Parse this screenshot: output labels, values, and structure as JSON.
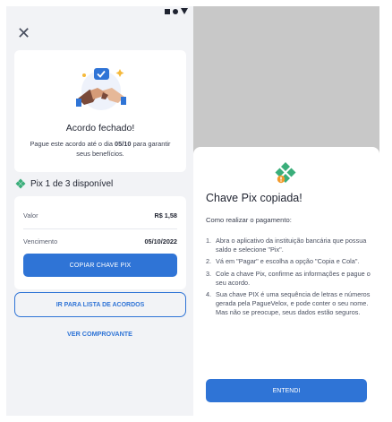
{
  "left_screen": {
    "close_icon": "close-icon",
    "success_card": {
      "title": "Acordo fechado!",
      "subtitle_pre": "Pague este acordo até o dia ",
      "subtitle_date": "05/10",
      "subtitle_post": " para garantir seus benefícios.",
      "illustration_icon": "handshake-icon"
    },
    "pix_header": {
      "icon": "pix-icon",
      "label": "Pix 1 de 3 disponível"
    },
    "payment_card": {
      "value_label": "Valor",
      "value": "R$ 1,58",
      "due_label": "Vencimento",
      "due_date": "05/10/2022",
      "copy_button": "COPIAR CHAVE PIX"
    },
    "list_button": "IR PARA LISTA DE ACORDOS",
    "receipt_link": "VER COMPROVANTE"
  },
  "right_screen": {
    "sheet": {
      "icon": "pix-logo-icon",
      "title": "Chave Pix copiada!",
      "subtitle": "Como realizar o pagamento:",
      "steps": [
        {
          "num": "1.",
          "text": "Abra o aplicativo da instituição bancária que possua saldo e selecione \"Pix\"."
        },
        {
          "num": "2.",
          "text": "Vá em \"Pagar\" e escolha a opção \"Copia e Cola\"."
        },
        {
          "num": "3.",
          "text": "Cole a chave Pix, confirme as informações e pague o seu acordo."
        },
        {
          "num": "4.",
          "text": "Sua chave PIX é uma sequência de letras e números gerada pela PagueVelox, e pode conter o seu nome. Mas não se preocupe, seus dados estão seguros."
        }
      ],
      "ok_button": "ENTENDI"
    }
  },
  "colors": {
    "primary": "#2f74d6",
    "pix_green": "#3aae7a",
    "background": "#f2f3f6",
    "overlay": "#c8c8c8"
  }
}
